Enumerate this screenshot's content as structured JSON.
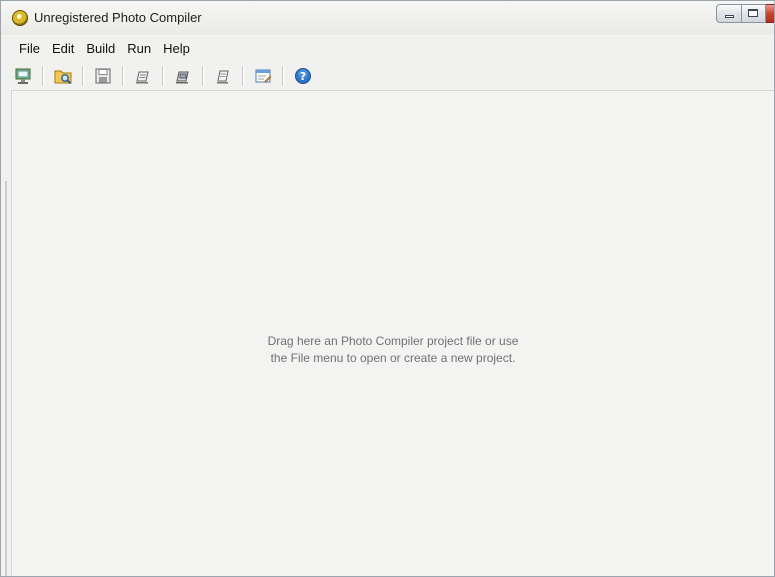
{
  "window": {
    "title": "Unregistered Photo Compiler"
  },
  "menubar": {
    "items": [
      {
        "label": "File"
      },
      {
        "label": "Edit"
      },
      {
        "label": "Build"
      },
      {
        "label": "Run"
      },
      {
        "label": "Help"
      }
    ]
  },
  "toolbar": {
    "buttons": [
      {
        "icon": "new-project-icon"
      },
      {
        "icon": "open-folder-icon"
      },
      {
        "icon": "save-icon"
      },
      {
        "icon": "edit-icon"
      },
      {
        "icon": "build-icon"
      },
      {
        "icon": "print-icon"
      },
      {
        "icon": "properties-icon"
      },
      {
        "icon": "help-icon"
      }
    ]
  },
  "content": {
    "hint_line1": "Drag here an Photo Compiler project file or use",
    "hint_line2": "the File menu to open or create a new project."
  }
}
